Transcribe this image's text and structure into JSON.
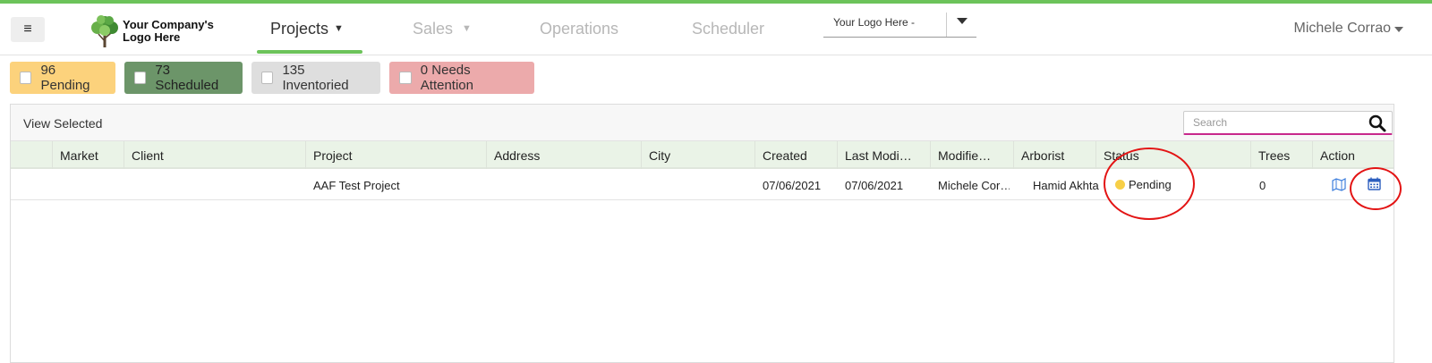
{
  "navbar": {
    "menu_icon": "hamburger-icon",
    "logo_line1": "Your Company's",
    "logo_line2": "Logo Here",
    "tabs": [
      {
        "label": "Projects",
        "active": true
      },
      {
        "label": "Sales",
        "active": false
      },
      {
        "label": "Operations",
        "active": false
      },
      {
        "label": "Scheduler",
        "active": false
      }
    ],
    "logo_select_value": "Your Logo Here -",
    "user_name": "Michele Corrao"
  },
  "filters": [
    {
      "label": "96 Pending",
      "color": "#fcd27c"
    },
    {
      "label": "73 Scheduled",
      "color": "#6c9569"
    },
    {
      "label": "135 Inventoried",
      "color": "#dedede"
    },
    {
      "label": "0 Needs Attention",
      "color": "#ecaaab"
    }
  ],
  "toolbar": {
    "view_selected": "View Selected",
    "search_placeholder": "Search"
  },
  "table": {
    "columns": [
      "",
      "Market",
      "Client",
      "Project",
      "Address",
      "City",
      "Created",
      "Last Modi…",
      "Modifie…",
      "Arborist",
      "Status",
      "Trees",
      "Action"
    ],
    "rows": [
      {
        "market": "",
        "client": "",
        "project": "AAF Test Project",
        "address": "",
        "city": "",
        "created": "07/06/2021",
        "last_modified": "07/06/2021",
        "modified_by": "Michele Cor…",
        "arborist": "Hamid Akhta",
        "status": "Pending",
        "status_color": "#f7cf47",
        "trees": "0",
        "actions": [
          "map-icon",
          "calendar-icon"
        ]
      }
    ]
  },
  "annotation_color": "#e31414"
}
